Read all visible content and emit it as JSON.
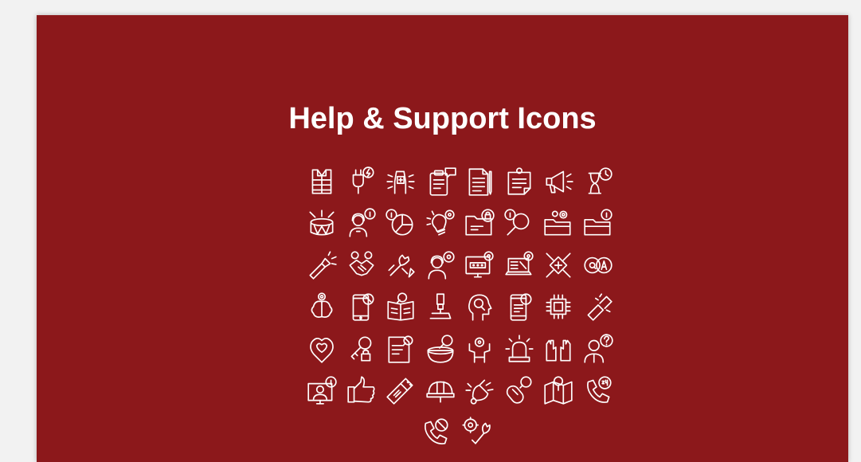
{
  "slide": {
    "background_color": "#8c181b",
    "title": "Help & Support Icons",
    "icon_rows": [
      [
        "safety-vest-icon",
        "power-plug-icon",
        "hand-badge-icon",
        "clipboard-chat-icon",
        "document-pen-icon",
        "note-pin-icon",
        "megaphone-icon",
        "hourglass-clock-icon"
      ],
      [
        "drum-burst-icon",
        "support-agent-info-icon",
        "pie-chart-info-icon",
        "lightbulb-gear-icon",
        "locked-folder-icon",
        "magnifier-info-icon",
        "folder-gear-icon",
        "folder-info-icon"
      ],
      [
        "flashlight-icon",
        "handshake-people-icon",
        "tools-hand-icon",
        "support-agent-gear-icon",
        "monitor-password-icon",
        "laptop-settings-icon",
        "hands-together-icon",
        "qa-bubbles-icon"
      ],
      [
        "brain-gear-icon",
        "phone-no-signal-icon",
        "book-search-icon",
        "microscope-icon",
        "head-search-icon",
        "phone-info-icon",
        "cpu-chip-icon",
        "broken-battery-icon"
      ],
      [
        "heart-location-icon",
        "key-lock-icon",
        "document-search-icon",
        "bowl-search-icon",
        "person-gear-icon",
        "alarm-siren-icon",
        "gloves-icon",
        "person-question-icon"
      ],
      [
        "computer-user-info-icon",
        "thumbs-up-icon",
        "usb-drive-icon",
        "hard-hat-icon",
        "bell-ring-icon",
        "mouse-search-icon",
        "map-location-icon",
        "phone-24h-icon"
      ],
      [
        "phone-blocked-icon",
        "gear-wrench-icon"
      ]
    ]
  }
}
